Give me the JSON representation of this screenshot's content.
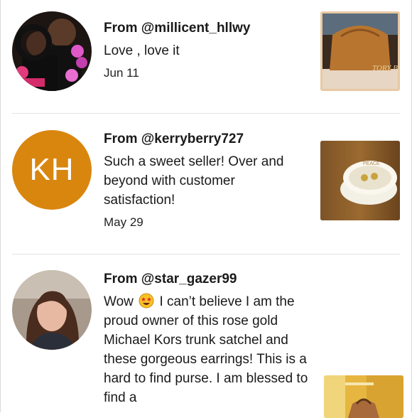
{
  "reviews": [
    {
      "from": "From @millicent_hllwy",
      "message": "Love , love it",
      "date": "Jun 11",
      "avatar_icon": "user-photo-couple",
      "thumb_icon": "tan-handbag-photo",
      "thumb_text": "TORY BURCH"
    },
    {
      "from": "From @kerryberry727",
      "message": "Such a sweet seller! Over and beyond with customer satisfaction!",
      "date": "May 29",
      "avatar_initials": "KH",
      "avatar_color": "#d9860f",
      "thumb_icon": "jewelry-dish-photo",
      "thumb_text": "PEACE"
    },
    {
      "from": "From @star_gazer99",
      "message_before_emoji": "Wow ",
      "emoji": "star-struck-emoji",
      "message_after_emoji": " I can’t believe I am the proud owner of this rose gold Michael Kors trunk satchel and these gorgeous earrings! This is a hard to find purse. I am blessed to find a",
      "avatar_icon": "user-photo-woman",
      "thumb_icon": "satchel-photo"
    }
  ]
}
